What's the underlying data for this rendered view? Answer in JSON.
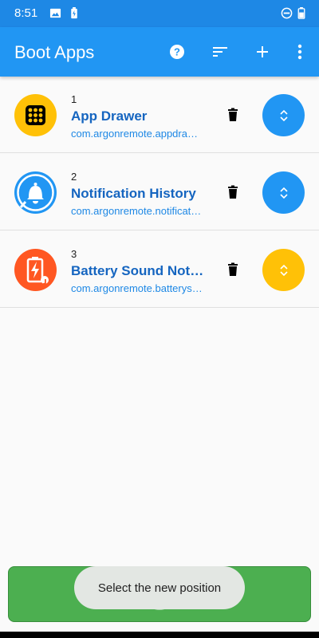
{
  "status_bar": {
    "time": "8:51",
    "icons": [
      "image-icon",
      "battery-alert-icon",
      "do-not-disturb-icon",
      "battery-icon"
    ]
  },
  "app_bar": {
    "title": "Boot Apps",
    "actions": [
      "help-icon",
      "sort-icon",
      "add-icon",
      "more-vert-icon"
    ]
  },
  "apps": [
    {
      "index": "1",
      "name": "App Drawer",
      "package": "com.argonremote.appdrawer",
      "icon": "app-drawer-icon",
      "icon_color": "#FFC107",
      "move_color": "#2196F3"
    },
    {
      "index": "2",
      "name": "Notification History",
      "package": "com.argonremote.notificationhistory",
      "icon": "notification-bell-icon",
      "icon_color": "#2196F3",
      "move_color": "#2196F3"
    },
    {
      "index": "3",
      "name": "Battery Sound Notification",
      "package": "com.argonremote.batterysound",
      "icon": "battery-sound-icon",
      "icon_color": "#FF5722",
      "move_color": "#FFC107"
    }
  ],
  "toast": {
    "text": "Select the new position"
  },
  "colors": {
    "primary": "#2196F3",
    "primary_dark": "#1E88E5",
    "accent": "#FFC107",
    "action_bar": "#4CAF50"
  }
}
